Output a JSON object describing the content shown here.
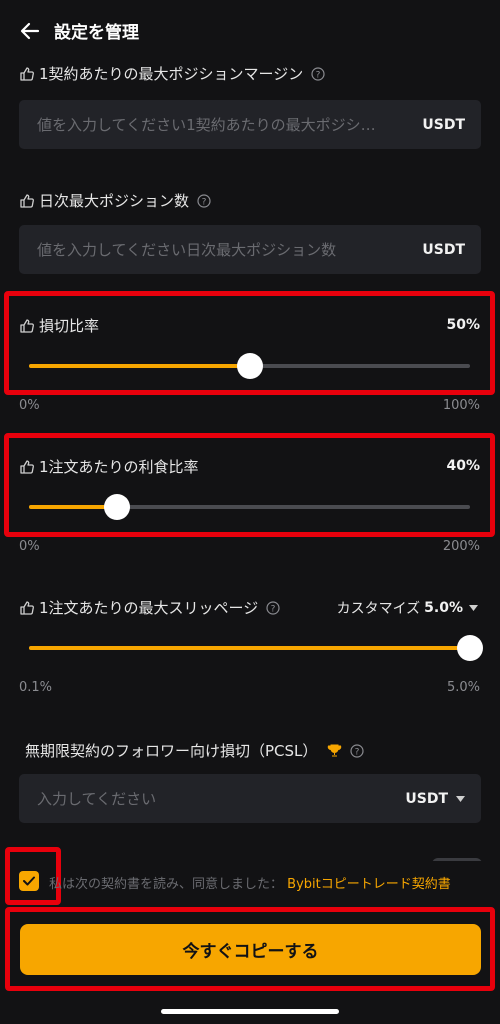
{
  "header": {
    "title": "設定を管理"
  },
  "max_margin": {
    "label": "1契約あたりの最大ポジションマージン",
    "placeholder": "値を入力してください1契約あたりの最大ポジシ…",
    "unit": "USDT"
  },
  "daily_positions": {
    "label": "日次最大ポジション数",
    "placeholder": "値を入力してください日次最大ポジション数",
    "unit": "USDT"
  },
  "stop_loss": {
    "label": "損切比率",
    "value_text": "50%",
    "value": 0.5,
    "min": "0%",
    "max": "100%"
  },
  "take_profit": {
    "label": "1注文あたりの利食比率",
    "value_text": "40%",
    "value": 0.2,
    "min": "0%",
    "max": "200%"
  },
  "slippage": {
    "label": "1注文あたりの最大スリッページ",
    "mode_label": "カスタマイズ",
    "mode_value": "5.0%",
    "value": 1.0,
    "min": "0.1%",
    "max": "5.0%"
  },
  "pcsl": {
    "label": "無期限契約のフォロワー向け損切（PCSL）",
    "placeholder": "入力してください",
    "unit": "USDT"
  },
  "agreement": {
    "checked": true,
    "text": "私は次の契約書を読み、同意しました：",
    "link": "Bybitコピートレード契約書"
  },
  "copy_button": {
    "label": "今すぐコピーする"
  },
  "colors": {
    "accent": "#f7a600",
    "background": "#121214",
    "highlight": "#e8000c"
  }
}
